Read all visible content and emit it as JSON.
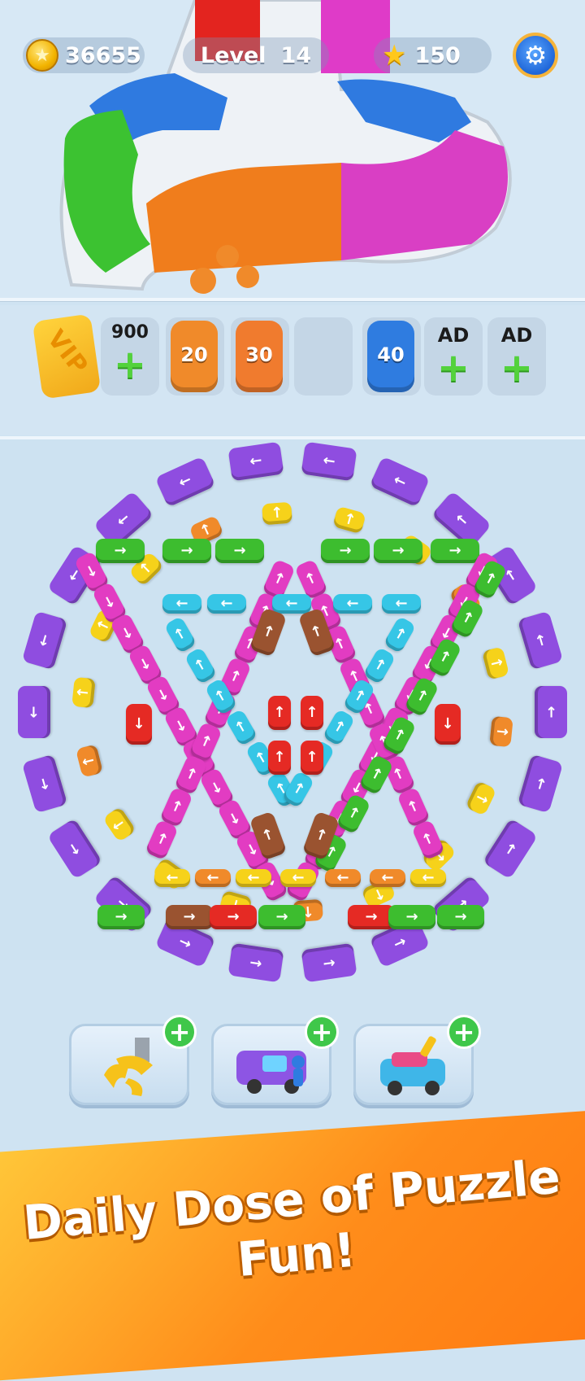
{
  "hud": {
    "coins": "36655",
    "level_label": "Level",
    "level_value": "14",
    "stars": "150"
  },
  "slots": [
    {
      "type": "vip",
      "label": "VIP"
    },
    {
      "type": "buy",
      "price": "900",
      "plus": "+"
    },
    {
      "type": "car",
      "color": "#f08a2a",
      "value": "20"
    },
    {
      "type": "car",
      "color": "#f07b2e",
      "value": "30"
    },
    {
      "type": "empty"
    },
    {
      "type": "car",
      "color": "#2f7ce0",
      "value": "40"
    },
    {
      "type": "ad",
      "label": "AD",
      "plus": "+"
    },
    {
      "type": "ad",
      "label": "AD",
      "plus": "+"
    }
  ],
  "boosters": [
    {
      "name": "claw"
    },
    {
      "name": "van"
    },
    {
      "name": "paint"
    }
  ],
  "banner": {
    "text": "Daily Dose of Puzzle Fun!"
  },
  "colors": {
    "purple": "#8f4de0",
    "green": "#3dbd2f",
    "magenta": "#e23cc2",
    "cyan": "#36c6e6",
    "yellow": "#f6d21a",
    "orange": "#f08a2a",
    "red": "#e52a24",
    "brown": "#9a5330",
    "blue": "#2f7ce0"
  },
  "icons": {
    "settings": "gear-icon",
    "coin": "coin-icon",
    "star": "star-icon"
  }
}
